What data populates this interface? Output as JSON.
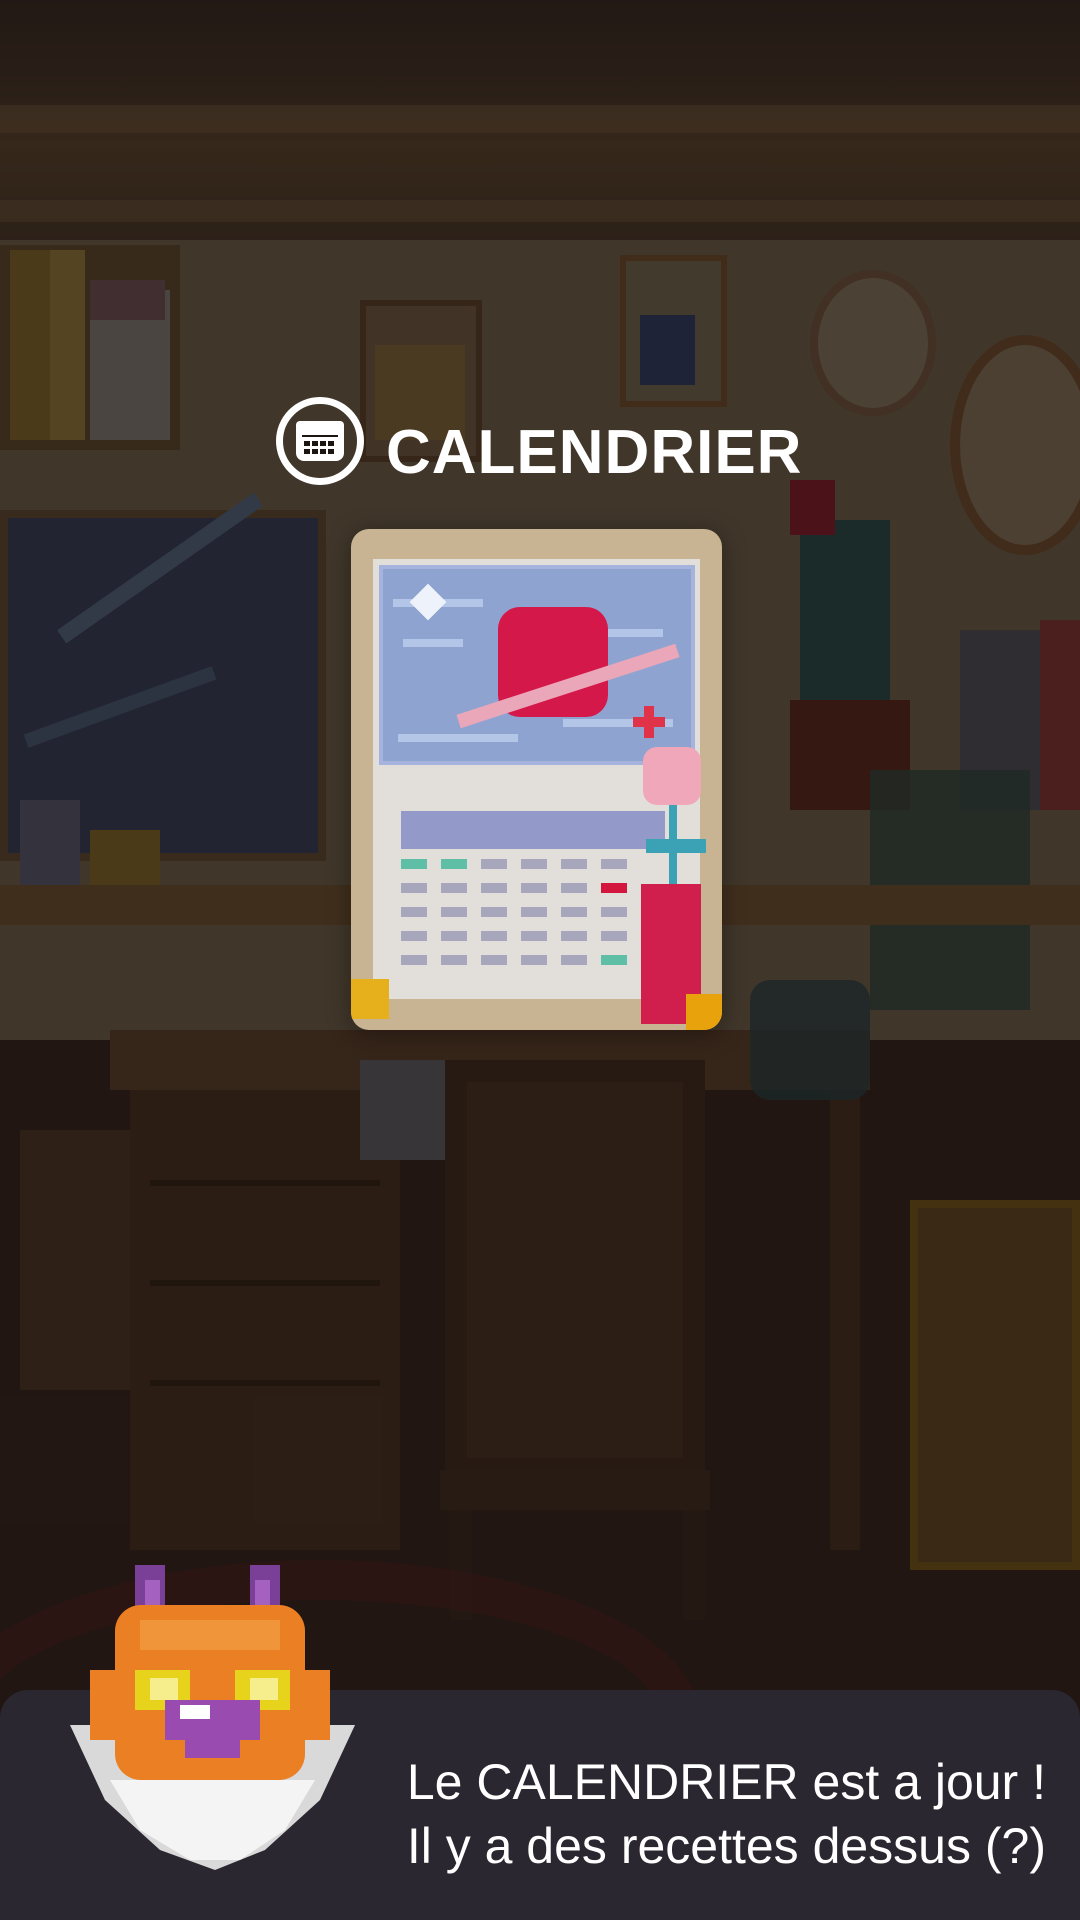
{
  "popup": {
    "title": "CALENDRIER",
    "icon": "calendar-icon",
    "item_name": "calendrier"
  },
  "dialog": {
    "speaker_icon": "orange-cat-avatar",
    "lines": [
      "Le CALENDRIER est a jour !",
      "Il y a des recettes dessus (?)"
    ]
  },
  "colors": {
    "dialog_bg": "#2a2730",
    "text": "#ffffff",
    "card_bg": "#c8b493"
  }
}
